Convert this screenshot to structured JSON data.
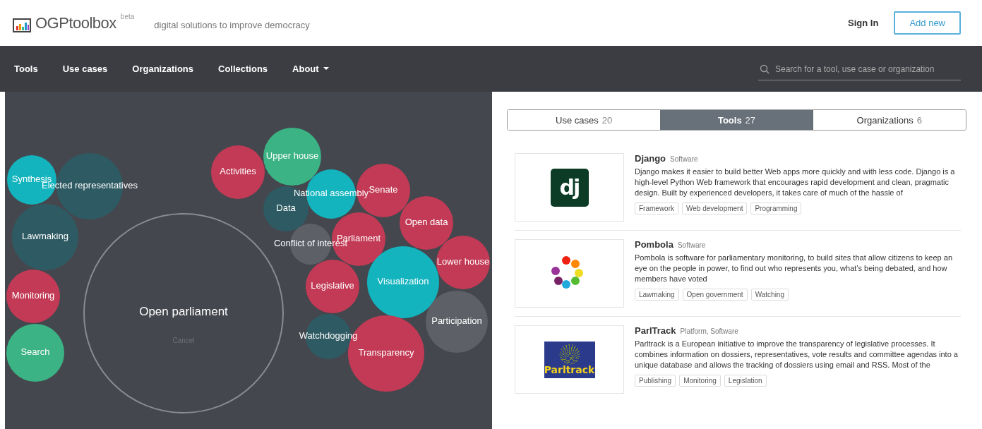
{
  "header": {
    "logo_text": "OGPtoolbox",
    "logo_badge": "beta",
    "tagline": "digital solutions to improve democracy",
    "sign_in": "Sign In",
    "add_button": "Add new"
  },
  "nav": {
    "items": [
      {
        "label": "Tools",
        "dropdown": false
      },
      {
        "label": "Use cases",
        "dropdown": false
      },
      {
        "label": "Organizations",
        "dropdown": false
      },
      {
        "label": "Collections",
        "dropdown": false
      },
      {
        "label": "About",
        "dropdown": true
      }
    ],
    "search": {
      "placeholder": "Search for a tool, use case or organization"
    }
  },
  "bubbles": {
    "center": {
      "label": "Open parliament",
      "action": "Cancel"
    },
    "items": [
      {
        "label": "Synthesis",
        "color": "#13b4be"
      },
      {
        "label": "Elected representatives",
        "color": "#2e5a63"
      },
      {
        "label": "Lawmaking",
        "color": "#2e5a63"
      },
      {
        "label": "Monitoring",
        "color": "#c23a55"
      },
      {
        "label": "Search",
        "color": "#3bb385"
      },
      {
        "label": "Activities",
        "color": "#c23a55"
      },
      {
        "label": "Upper house",
        "color": "#3bb385"
      },
      {
        "label": "National assembly",
        "color": "#13b4be"
      },
      {
        "label": "Data",
        "color": "#2e5a63"
      },
      {
        "label": "Senate",
        "color": "#c23a55"
      },
      {
        "label": "Open data",
        "color": "#c23a55"
      },
      {
        "label": "Conflict of interest",
        "color": "#5e6068"
      },
      {
        "label": "Parliament",
        "color": "#c23a55"
      },
      {
        "label": "Lower house",
        "color": "#c23a55"
      },
      {
        "label": "Legislative",
        "color": "#c23a55"
      },
      {
        "label": "Visualization",
        "color": "#13b4be"
      },
      {
        "label": "Participation",
        "color": "#5e6068"
      },
      {
        "label": "Watchdogging",
        "color": "#2e5a63"
      },
      {
        "label": "Transparency",
        "color": "#c23a55"
      }
    ]
  },
  "tabs": [
    {
      "label": "Use cases",
      "count": "20",
      "selected": false
    },
    {
      "label": "Tools",
      "count": "27",
      "selected": true
    },
    {
      "label": "Organizations",
      "count": "6",
      "selected": false
    }
  ],
  "tools": [
    {
      "name": "Django",
      "type": "Software",
      "kind": "django",
      "logo_text": "dj",
      "description": "Django makes it easier to build better Web apps more quickly and with less code. Django is a high-level Python Web framework that encourages rapid development and clean, pragmatic design. Built by experienced developers, it takes care of much of the hassle of",
      "tags": [
        "Framework",
        "Web development",
        "Programming"
      ]
    },
    {
      "name": "Pombola",
      "type": "Software",
      "kind": "dots",
      "description": "Pombola is software for parliamentary monitoring, to build sites that allow citizens to keep an eye on the people in power, to find out who represents you, what’s being debated, and how members have voted",
      "tags": [
        "Lawmaking",
        "Open government",
        "Watching"
      ]
    },
    {
      "name": "ParlTrack",
      "type": "Platform, Software",
      "kind": "parltrack",
      "logo_text": "Parltrack",
      "description": "Parltrack is a European initiative to improve the transparency of legislative processes. It combines information on dossiers, representatives, vote results and committee agendas into a unique database and allows the tracking of dossiers using email and RSS. Most of the",
      "tags": [
        "Publishing",
        "Monitoring",
        "Legislation"
      ]
    }
  ]
}
